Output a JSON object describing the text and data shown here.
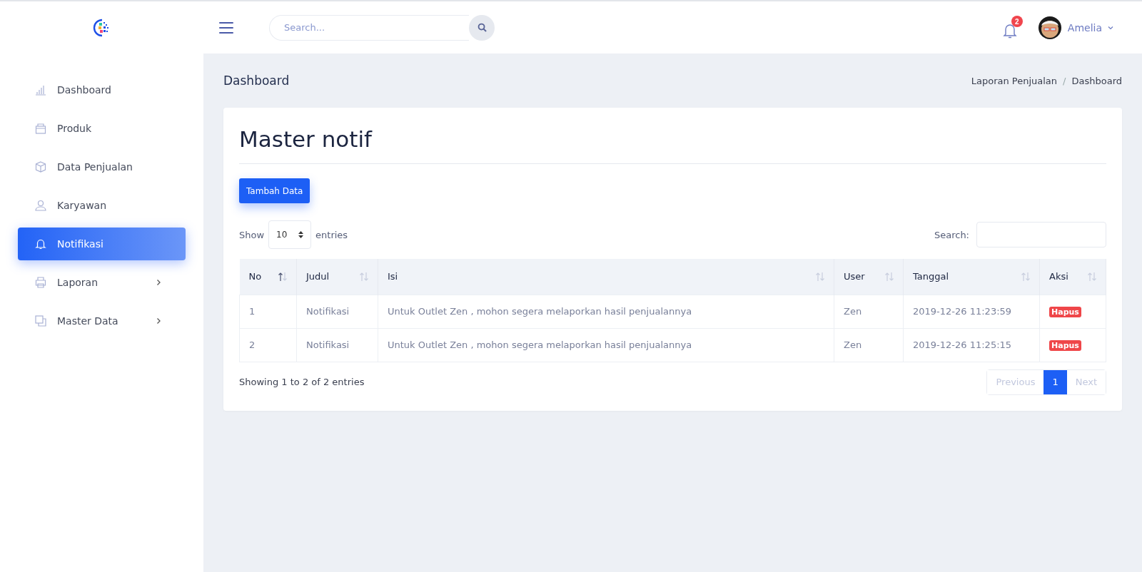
{
  "topbar": {
    "search": {
      "placeholder": "Search..."
    },
    "notifications": {
      "count": "2"
    },
    "user": {
      "name": "Amelia"
    }
  },
  "sidebar": {
    "items": [
      {
        "label": "Dashboard",
        "kind": "chart",
        "selected": false,
        "submenu": false
      },
      {
        "label": "Produk",
        "kind": "bag",
        "selected": false,
        "submenu": false
      },
      {
        "label": "Data Penjualan",
        "kind": "box",
        "selected": false,
        "submenu": false
      },
      {
        "label": "Karyawan",
        "kind": "user",
        "selected": false,
        "submenu": false
      },
      {
        "label": "Notifikasi",
        "kind": "bell",
        "selected": true,
        "submenu": false
      },
      {
        "label": "Laporan",
        "kind": "printer",
        "selected": false,
        "submenu": true
      },
      {
        "label": "Master Data",
        "kind": "copy",
        "selected": false,
        "submenu": true
      }
    ]
  },
  "page": {
    "title": "Dashboard",
    "breadcrumb": [
      "Laporan Penjualan",
      "Dashboard"
    ],
    "breadcrumb_separator": "/"
  },
  "card": {
    "title": "Master notif",
    "add_button": "Tambah Data",
    "length": {
      "label_before": "Show",
      "value": "10",
      "label_after": "entries"
    },
    "search_label": "Search:",
    "table": {
      "columns": [
        {
          "label": "No",
          "sorted": true
        },
        {
          "label": "Judul",
          "sorted": false
        },
        {
          "label": "Isi",
          "sorted": false
        },
        {
          "label": "User",
          "sorted": false
        },
        {
          "label": "Tanggal",
          "sorted": false
        },
        {
          "label": "Aksi",
          "sorted": false
        }
      ],
      "rows": [
        {
          "no": "1",
          "judul": "Notifikasi",
          "isi": "Untuk Outlet Zen , mohon segera melaporkan hasil penjualannya",
          "user": "Zen",
          "tanggal": "2019-12-26 11:23:59",
          "action": "Hapus"
        },
        {
          "no": "2",
          "judul": "Notifikasi",
          "isi": "Untuk Outlet Zen , mohon segera melaporkan hasil penjualannya",
          "user": "Zen",
          "tanggal": "2019-12-26 11:25:15",
          "action": "Hapus"
        }
      ]
    },
    "info": "Showing 1 to 2 of 2 entries",
    "pagination": {
      "previous": {
        "label": "Previous",
        "disabled": true
      },
      "pages": [
        {
          "label": "1",
          "selected": true
        }
      ],
      "next": {
        "label": "Next",
        "disabled": true
      }
    }
  }
}
